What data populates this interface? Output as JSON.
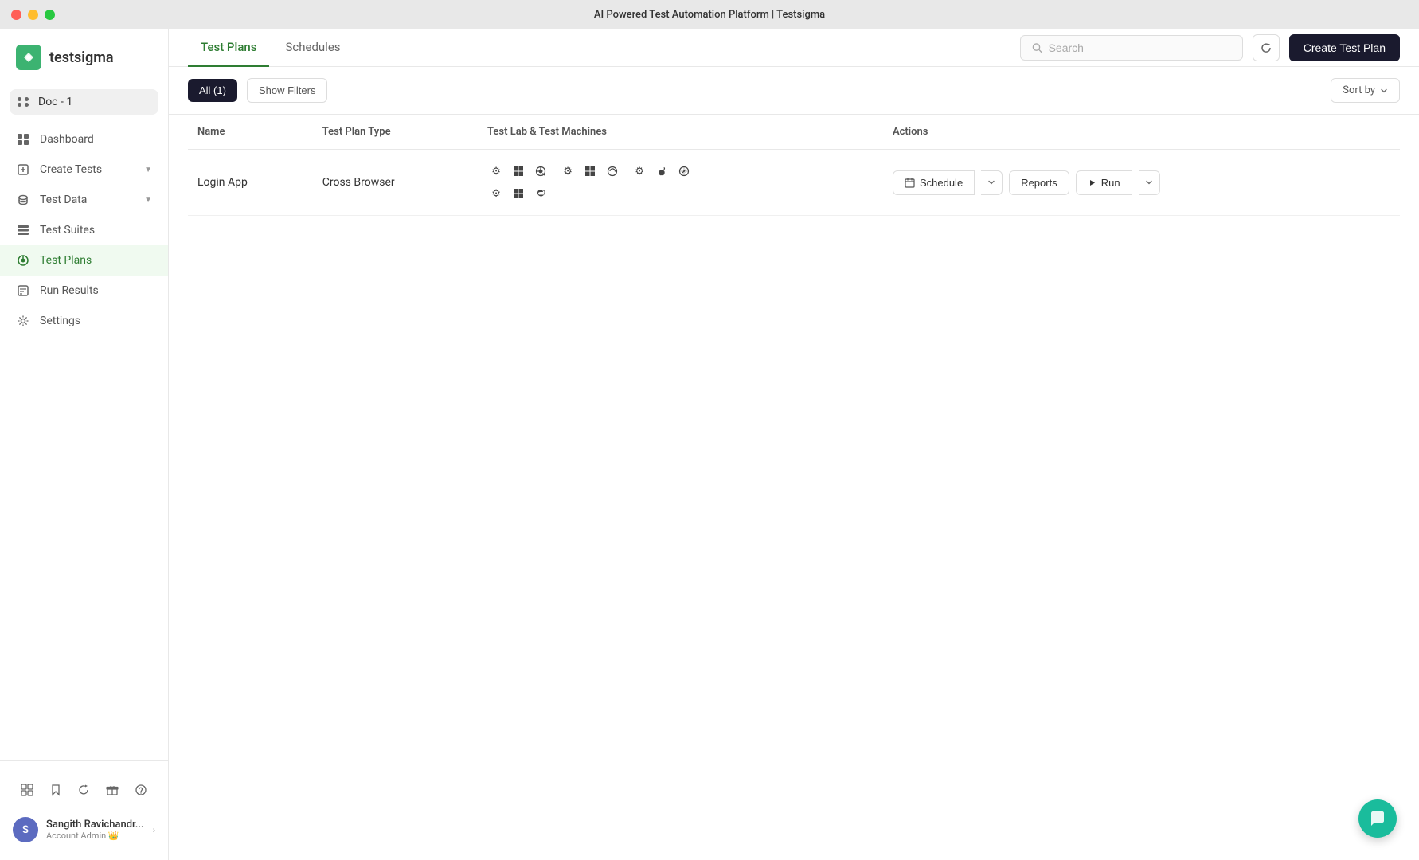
{
  "titlebar": {
    "title": "AI Powered Test Automation Platform | Testsigma"
  },
  "sidebar": {
    "logo_text": "testsigma",
    "workspace": {
      "label": "Doc - 1"
    },
    "nav_items": [
      {
        "id": "dashboard",
        "label": "Dashboard",
        "icon": "dashboard-icon",
        "active": false
      },
      {
        "id": "create-tests",
        "label": "Create Tests",
        "icon": "create-tests-icon",
        "active": false,
        "has_chevron": true
      },
      {
        "id": "test-data",
        "label": "Test Data",
        "icon": "test-data-icon",
        "active": false,
        "has_chevron": true
      },
      {
        "id": "test-suites",
        "label": "Test Suites",
        "icon": "test-suites-icon",
        "active": false
      },
      {
        "id": "test-plans",
        "label": "Test Plans",
        "icon": "test-plans-icon",
        "active": true
      },
      {
        "id": "run-results",
        "label": "Run Results",
        "icon": "run-results-icon",
        "active": false
      },
      {
        "id": "settings",
        "label": "Settings",
        "icon": "settings-icon",
        "active": false
      }
    ],
    "bottom_icons": [
      {
        "id": "addons",
        "icon": "addons-icon"
      },
      {
        "id": "bookmark",
        "icon": "bookmark-icon"
      },
      {
        "id": "refresh",
        "icon": "refresh-icon"
      },
      {
        "id": "gift",
        "icon": "gift-icon"
      },
      {
        "id": "help",
        "icon": "help-icon"
      }
    ],
    "user": {
      "initials": "S",
      "name": "Sangith Ravichandr...",
      "role": "Account Admin 👑"
    }
  },
  "main": {
    "tabs": [
      {
        "id": "test-plans",
        "label": "Test Plans",
        "active": true
      },
      {
        "id": "schedules",
        "label": "Schedules",
        "active": false
      }
    ],
    "search": {
      "placeholder": "Search"
    },
    "create_button": "Create Test Plan",
    "filters": {
      "all_label": "All (1)",
      "show_filters_label": "Show Filters"
    },
    "sort_by": "Sort by",
    "table": {
      "columns": [
        {
          "id": "name",
          "label": "Name"
        },
        {
          "id": "test-plan-type",
          "label": "Test Plan Type"
        },
        {
          "id": "test-lab",
          "label": "Test Lab & Test Machines"
        },
        {
          "id": "actions",
          "label": "Actions"
        }
      ],
      "rows": [
        {
          "id": "login-app",
          "name": "Login App",
          "test_plan_type": "Cross Browser",
          "actions": {
            "schedule_label": "Schedule",
            "reports_label": "Reports",
            "run_label": "Run"
          }
        }
      ]
    }
  },
  "chat": {
    "icon": "chat-icon"
  },
  "colors": {
    "active_nav": "#2e7d32",
    "active_tab": "#2e7d32",
    "create_button_bg": "#1a1a2e",
    "chat_bg": "#1abc9c"
  }
}
